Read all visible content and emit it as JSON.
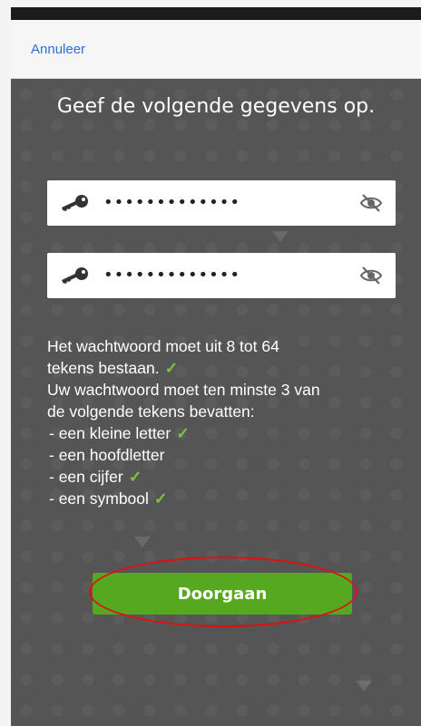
{
  "header": {
    "cancel_label": "Annuleer"
  },
  "main": {
    "title": "Geef de volgende gegevens op.",
    "password_field": {
      "value": "•••••••••••••"
    },
    "confirm_field": {
      "value": "•••••••••••••"
    },
    "rules": {
      "length_line1": "Het wachtwoord moet uit 8 tot 64",
      "length_line2": "tekens bestaan.",
      "require_line1": "Uw wachtwoord moet ten minste 3 van",
      "require_line2": "de volgende tekens bevatten:",
      "items": [
        {
          "label": "- een kleine letter",
          "met": true
        },
        {
          "label": "- een hoofdletter",
          "met": false
        },
        {
          "label": "- een cijfer",
          "met": true
        },
        {
          "label": "- een symbool",
          "met": true
        }
      ],
      "check_glyph": "✓"
    },
    "continue_button": "Doorgaan"
  },
  "colors": {
    "accent_green": "#56a820",
    "check_green": "#7cc242",
    "link_blue": "#2a6fd6",
    "annotation_red": "#e01010"
  },
  "icons": {
    "field_icon": "key-icon",
    "toggle_icon": "eye-slash-icon"
  }
}
